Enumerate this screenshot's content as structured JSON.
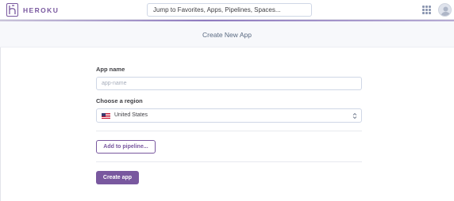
{
  "brand": {
    "name": "HEROKU",
    "color": "#79589f"
  },
  "search": {
    "placeholder": "Jump to Favorites, Apps, Pipelines, Spaces..."
  },
  "header": {
    "title": "Create New App"
  },
  "form": {
    "app_name": {
      "label": "App name",
      "placeholder": "app-name",
      "value": ""
    },
    "region": {
      "label": "Choose a region",
      "selected": "United States",
      "flag": "us-flag-icon"
    },
    "add_pipeline_label": "Add to pipeline...",
    "create_label": "Create app"
  },
  "icons": {
    "apps": "grid-apps-icon",
    "avatar": "user-avatar-icon",
    "chevron": "chevron-updown-icon"
  }
}
